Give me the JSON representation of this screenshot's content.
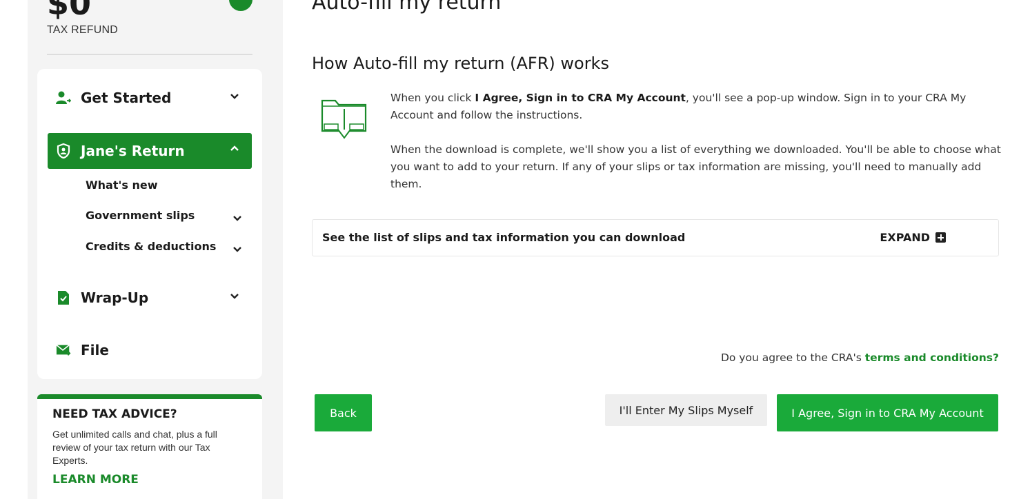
{
  "refund": {
    "amount": "$0",
    "label": "TAX REFUND"
  },
  "nav": {
    "get_started": "Get Started",
    "janes_return": "Jane's Return",
    "sub_items": [
      "What's new",
      "Government slips",
      "Credits & deductions"
    ],
    "wrap_up": "Wrap-Up",
    "file": "File"
  },
  "advice": {
    "title": "NEED TAX ADVICE?",
    "text": "Get unlimited calls and chat, plus a full review of your tax return with our Tax Experts.",
    "link": "LEARN MORE"
  },
  "main": {
    "page_title": "Auto-fill my return",
    "section_title": "How Auto-fill my return (AFR) works",
    "para1_prefix": "When you click ",
    "para1_bold": "I Agree, Sign in to CRA My Account",
    "para1_suffix": ", you'll see a pop-up window. Sign in to your CRA My Account and follow the instructions.",
    "para2": "When the download is complete, we'll show you a list of everything we downloaded. You'll be able to choose what you want to add to your return. If any of your slips or tax information are missing, you'll need to manually add them.",
    "expand_label": "See the list of slips and tax information you can download",
    "expand_button": "EXPAND",
    "terms_prefix": "Do you agree to the CRA's ",
    "terms_link": "terms and conditions?",
    "back_button": "Back",
    "self_button": "I'll Enter My Slips Myself",
    "agree_button": "I Agree, Sign in to CRA My Account"
  },
  "colors": {
    "brand_green": "#1a8a2a",
    "button_green": "#1aaa3a"
  },
  "icons": [
    "user-add-icon",
    "shield-icon",
    "document-check-icon",
    "mail-send-icon",
    "chevron-down-icon",
    "chevron-up-icon",
    "download-folder-icon",
    "plus-box-icon"
  ]
}
